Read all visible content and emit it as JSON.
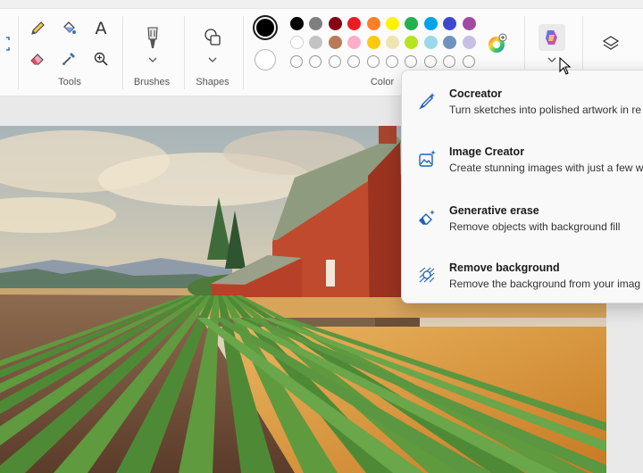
{
  "ribbon": {
    "groups": {
      "tools_label": "Tools",
      "brushes_label": "Brushes",
      "shapes_label": "Shapes",
      "color_label": "Color"
    },
    "text_tool_glyph": "A"
  },
  "colors": {
    "selected_primary": "#000000",
    "selected_secondary": "#ffffff",
    "palette_row1": [
      "#000000",
      "#7f7f7f",
      "#880015",
      "#ed1c24",
      "#ff7f27",
      "#fff200",
      "#22b14c",
      "#00a2e8",
      "#3f48cc",
      "#a349a4"
    ],
    "palette_row2": [
      "#ffffff",
      "#c3c3c3",
      "#b97a57",
      "#ffaec9",
      "#ffc90e",
      "#efe4b0",
      "#b5e61d",
      "#99d9ea",
      "#7092be",
      "#c8bfe7"
    ],
    "empty_slots": 10
  },
  "copilot_menu": {
    "items": [
      {
        "title": "Cocreator",
        "description": "Turn sketches into polished artwork in re",
        "icon": "brush-sparkle-icon"
      },
      {
        "title": "Image Creator",
        "description": "Create stunning images with just a few w",
        "icon": "image-sparkle-icon"
      },
      {
        "title": "Generative erase",
        "description": "Remove objects with background fill",
        "icon": "eraser-sparkle-icon"
      },
      {
        "title": "Remove background",
        "description": "Remove the background from your imag",
        "icon": "remove-background-icon"
      }
    ]
  }
}
